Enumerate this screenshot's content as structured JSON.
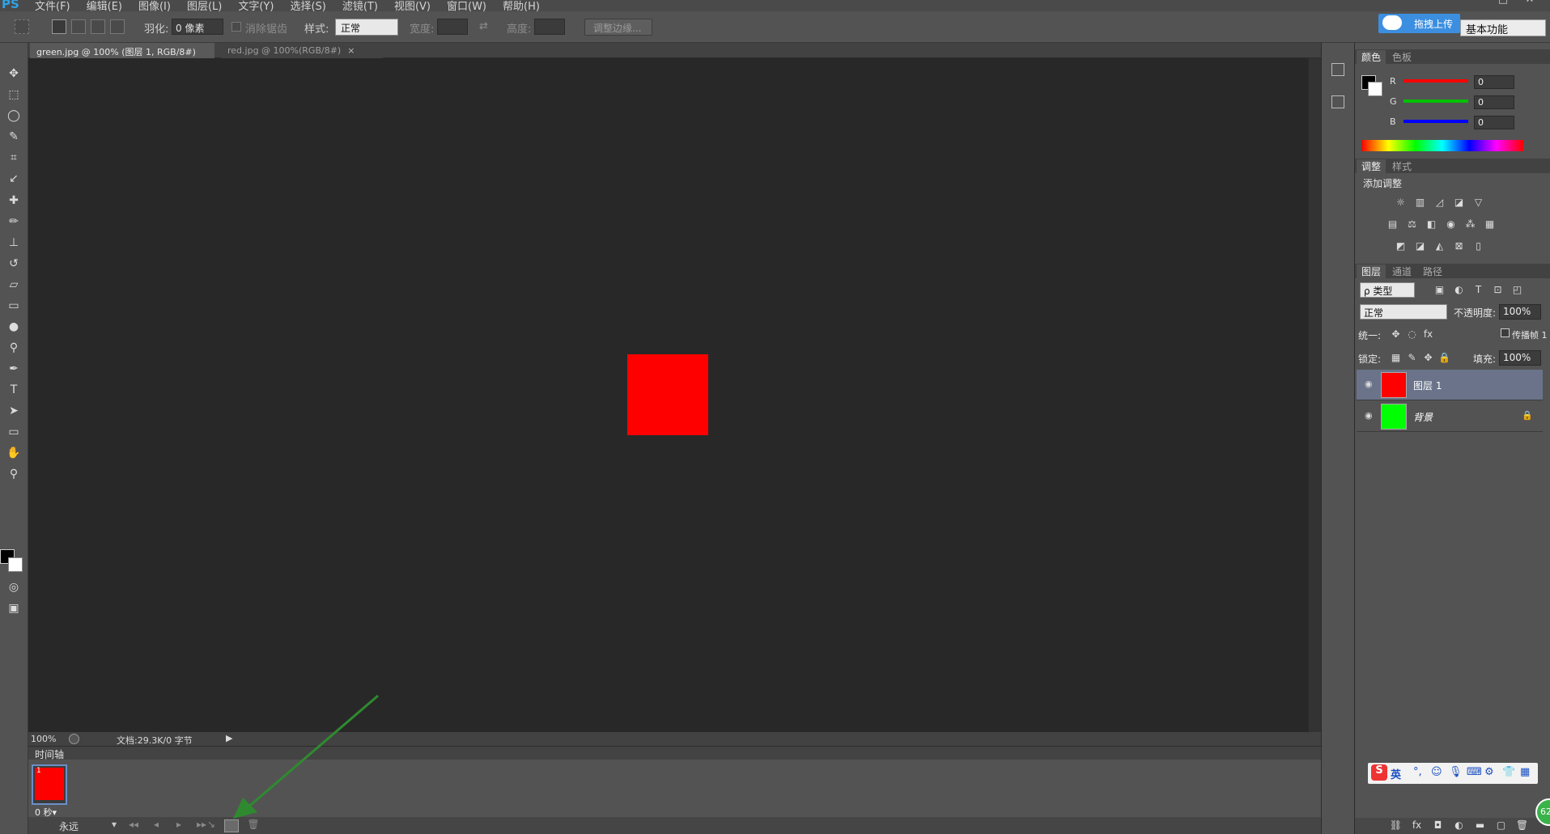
{
  "app": {
    "logo": "PS"
  },
  "menu": [
    "文件(F)",
    "编辑(E)",
    "图像(I)",
    "图层(L)",
    "文字(Y)",
    "选择(S)",
    "滤镜(T)",
    "视图(V)",
    "窗口(W)",
    "帮助(H)"
  ],
  "window_controls": {
    "minimize": "—",
    "maximize": "□",
    "close": "✕"
  },
  "options": {
    "feather_label": "羽化:",
    "feather_value": "0 像素",
    "antialias_label": "消除锯齿",
    "style_label": "样式:",
    "style_value": "正常",
    "width_label": "宽度:",
    "height_label": "高度:",
    "refine_edge": "调整边缘..."
  },
  "upload_button": "拖拽上传",
  "workspace_select": "基本功能",
  "tabs": [
    {
      "label": "green.jpg @ 100% (图层 1, RGB/8#) *",
      "close": "×"
    },
    {
      "label": "red.jpg @ 100%(RGB/8#)",
      "close": "×"
    }
  ],
  "status": {
    "zoom": "100%",
    "doc": "文档:29.3K/0 字节"
  },
  "timeline": {
    "title": "时间轴",
    "frame_number": "1",
    "frame_time": "0 秒▾",
    "loop": "永远"
  },
  "color_panel": {
    "tabs": [
      "颜色",
      "色板"
    ],
    "channels": [
      {
        "label": "R",
        "value": "0",
        "color": "#ff0000"
      },
      {
        "label": "G",
        "value": "0",
        "color": "#00c000"
      },
      {
        "label": "B",
        "value": "0",
        "color": "#0000ff"
      }
    ]
  },
  "adjust_panel": {
    "tabs": [
      "调整",
      "样式"
    ],
    "title": "添加调整"
  },
  "layers_panel": {
    "tabs": [
      "图层",
      "通道",
      "路径"
    ],
    "filter_value": "ρ 类型",
    "blend_mode": "正常",
    "opacity_label": "不透明度:",
    "opacity_value": "100%",
    "unify_label": "统一:",
    "propagate_label": "传播帧 1",
    "lock_label": "锁定:",
    "fill_label": "填充:",
    "fill_value": "100%",
    "layers": [
      {
        "name": "图层 1",
        "color": "#ff0000"
      },
      {
        "name": "背景",
        "color": "#00ff00"
      }
    ]
  },
  "ime": {
    "lang": "英"
  },
  "badge": "62"
}
